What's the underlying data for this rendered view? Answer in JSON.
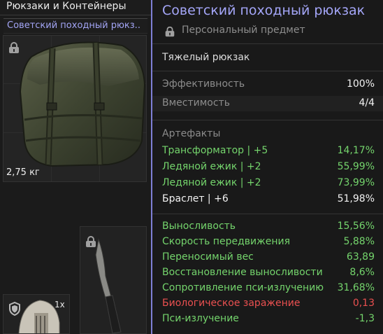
{
  "inventory": {
    "category_title": "Рюкзаки и Контейнеры",
    "selected_item": "Советский походный рюкз..",
    "item_weight": "2,75 кг",
    "helmet_quantity": "1x",
    "icons": [
      "lock-icon",
      "shield-icon"
    ]
  },
  "tooltip": {
    "item_name": "Советский походный рюкзак",
    "personal_label": "Персональный предмет",
    "item_class": "Тяжелый рюкзак",
    "stats": [
      {
        "label": "Эффективность",
        "value": "100%"
      },
      {
        "label": "Вместимость",
        "value": "4/4"
      }
    ],
    "artifacts_title": "Артефакты",
    "artifacts": [
      {
        "label": "Трансформатор | +5",
        "value": "14,17%",
        "color": "#74d46c"
      },
      {
        "label": "Ледяной ежик | +2",
        "value": "55,99%",
        "color": "#74d46c"
      },
      {
        "label": "Ледяной ежик | +2",
        "value": "73,99%",
        "color": "#74d46c"
      },
      {
        "label": "Браслет | +6",
        "value": "51,98%",
        "color": "#f2f2f2"
      }
    ],
    "effects": [
      {
        "label": "Выносливость",
        "value": "15,56%",
        "color": "#74d46c"
      },
      {
        "label": "Скорость передвижения",
        "value": "5,88%",
        "color": "#74d46c"
      },
      {
        "label": "Переносимый вес",
        "value": "63,89",
        "color": "#74d46c"
      },
      {
        "label": "Восстановление выносливости",
        "value": "8,6%",
        "color": "#74d46c"
      },
      {
        "label": "Сопротивление пси-излучению",
        "value": "31,68%",
        "color": "#74d46c"
      },
      {
        "label": "Биологическое заражение",
        "value": "0,13",
        "color": "#ea5050"
      },
      {
        "label": "Пси-излучение",
        "value": "-1,3",
        "color": "#74d46c"
      }
    ],
    "accent_color": "#a4a6f8"
  }
}
